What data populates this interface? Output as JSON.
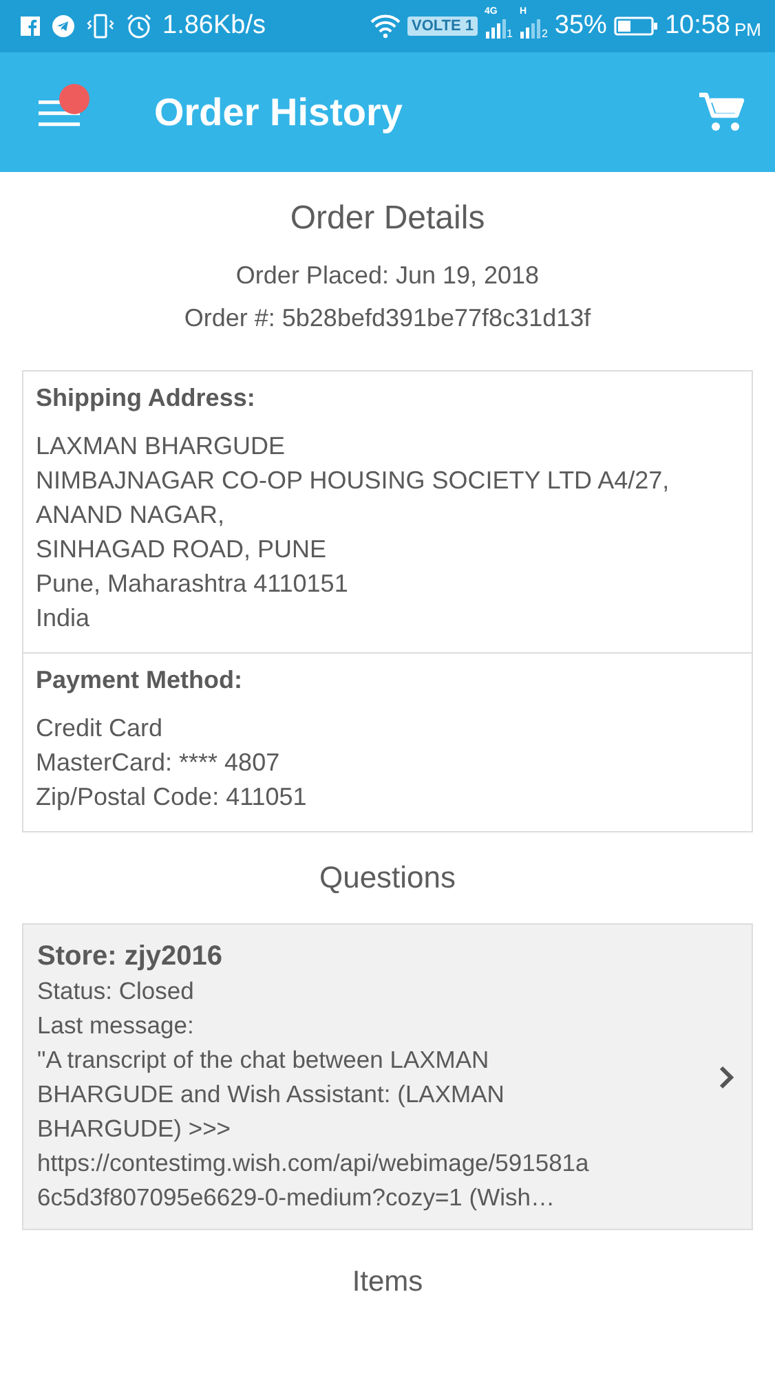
{
  "status_bar": {
    "speed": "1.86Kb/s",
    "volte": "VOLTE 1",
    "sim1_network": "4G",
    "sim1": "1",
    "sim2_network": "H",
    "sim2": "2",
    "battery": "35%",
    "time": "10:58",
    "ampm": "PM"
  },
  "app_bar": {
    "title": "Order History",
    "menu_badge": true
  },
  "order": {
    "heading": "Order Details",
    "placed": "Order Placed: Jun 19, 2018",
    "number": "Order #: 5b28befd391be77f8c31d13f"
  },
  "sections": [
    {
      "title": "Shipping Address:",
      "lines": [
        "LAXMAN BHARGUDE",
        "NIMBAJNAGAR CO-OP HOUSING SOCIETY LTD A4/27,",
        "ANAND NAGAR,",
        "SINHAGAD ROAD, PUNE",
        "Pune, Maharashtra 4110151",
        "India"
      ]
    },
    {
      "title": "Payment Method:",
      "lines": [
        "Credit Card",
        "MasterCard: **** 4807",
        "Zip/Postal Code: 411051"
      ]
    }
  ],
  "questions": {
    "heading": "Questions",
    "items": [
      {
        "store": "Store: zjy2016",
        "status": "Status: Closed",
        "label": "Last message:",
        "message": [
          "\"A transcript of the chat between LAXMAN",
          "BHARGUDE and Wish Assistant: (LAXMAN",
          "BHARGUDE) >>>",
          "https://contestimg.wish.com/api/webimage/591581a",
          "6c5d3f807095e6629-0-medium?cozy=1 (Wish…"
        ]
      }
    ]
  },
  "items_heading": "Items"
}
